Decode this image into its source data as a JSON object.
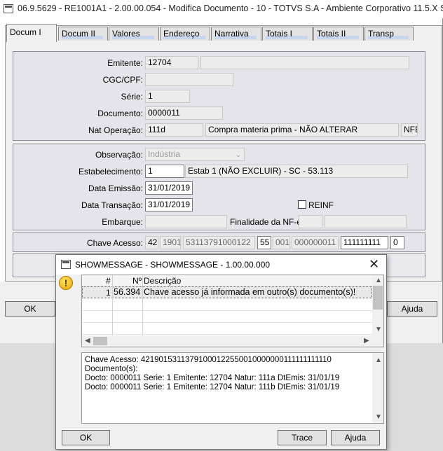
{
  "window": {
    "title": "06.9.5629 - RE1001A1 - 2.00.00.054 - Modifica Documento - 10 - TOTVS S.A - Ambiente Corporativo 11.5.X S..."
  },
  "tabs": [
    {
      "label": "Docum I"
    },
    {
      "label": "Docum II"
    },
    {
      "label": "Valores"
    },
    {
      "label": "Endereço"
    },
    {
      "label": "Narrativa"
    },
    {
      "label": "Totais I"
    },
    {
      "label": "Totais II"
    },
    {
      "label": "Transp"
    }
  ],
  "section1": {
    "emitente_label": "Emitente:",
    "emitente_value": "12704",
    "emitente_name": "",
    "cgc_label": "CGC/CPF:",
    "cgc_value": "",
    "serie_label": "Série:",
    "serie_value": "1",
    "documento_label": "Documento:",
    "documento_value": "0000011",
    "natop_label": "Nat Operação:",
    "natop_code": "111d",
    "natop_desc": "Compra materia prima - NÃO ALTERAR",
    "natop_type": "NFE"
  },
  "section2": {
    "obs_label": "Observação:",
    "obs_value": "Indústria",
    "estab_label": "Estabelecimento:",
    "estab_value": "1",
    "estab_desc": "Estab 1 (NÃO EXCLUIR) - SC - 53.113",
    "data_emissao_label": "Data Emissão:",
    "data_emissao_value": "31/01/2019",
    "data_transacao_label": "Data Transação:",
    "data_transacao_value": "31/01/2019",
    "reinf_label": "REINF",
    "embarque_label": "Embarque:",
    "embarque_value": "",
    "finalidade_label": "Finalidade da NF-e:",
    "finalidade_value": ""
  },
  "section3": {
    "chave_label": "Chave Acesso:",
    "parts": [
      "42",
      "1901",
      "53113791000122",
      "55",
      "001",
      "000000011",
      "111111111",
      "0"
    ]
  },
  "main_buttons": {
    "ok": "OK",
    "ajuda": "Ajuda"
  },
  "dialog": {
    "title": "SHOWMESSAGE - SHOWMESSAGE - 1.00.00.000",
    "close_glyph": "✕",
    "warning_glyph": "!",
    "grid": {
      "headers": [
        "#",
        "Nº",
        "Descrição"
      ],
      "rows": [
        {
          "num": "1",
          "code": "56.394",
          "desc": "Chave acesso já informada em outro(s) documento(s)!"
        }
      ]
    },
    "memo_lines": [
      "Chave Acesso: 42190153113791000122550010000000111111111110",
      "Documento(s):",
      "Docto: 0000011 Serie: 1 Emitente: 12704 Natur: 111a DtEmis: 31/01/19",
      "Docto: 0000011 Serie: 1 Emitente: 12704 Natur: 111b DtEmis: 31/01/19"
    ],
    "buttons": {
      "ok": "OK",
      "trace": "Trace",
      "ajuda": "Ajuda"
    }
  }
}
